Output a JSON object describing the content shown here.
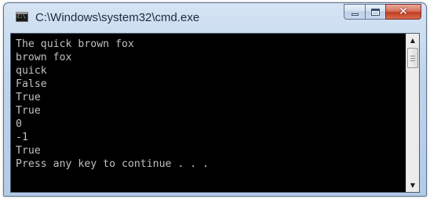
{
  "window": {
    "title": "C:\\Windows\\system32\\cmd.exe",
    "icon": "cmd-console-icon",
    "icon_text": "C:\\",
    "controls": {
      "minimize": "minimize-icon",
      "maximize": "maximize-icon",
      "close": "close-icon",
      "close_glyph": "✕"
    }
  },
  "console": {
    "lines": [
      "The quick brown fox",
      "brown fox",
      "quick",
      "False",
      "True",
      "True",
      "0",
      "-1",
      "True",
      "Press any key to continue . . ."
    ],
    "text_color": "#c0c0c0",
    "background": "#000000"
  },
  "scrollbar": {
    "up_glyph": "▲",
    "down_glyph": "▼"
  }
}
